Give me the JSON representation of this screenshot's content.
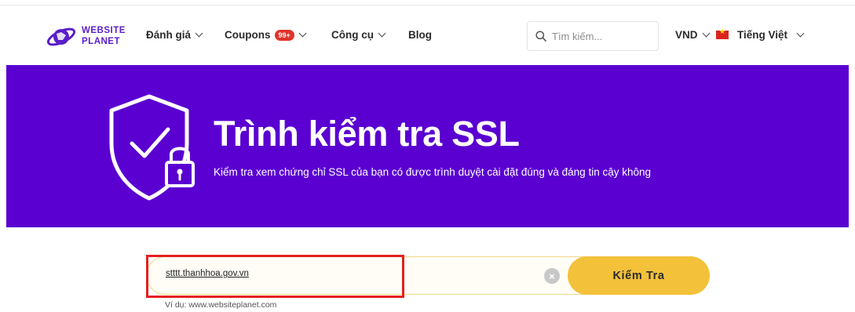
{
  "header": {
    "logo": {
      "line1": "WEBSITE",
      "line2": "PLANET"
    },
    "nav": [
      {
        "label": "Đánh giá",
        "has_dropdown": true
      },
      {
        "label": "Coupons",
        "badge": "99+",
        "has_dropdown": true
      },
      {
        "label": "Công cụ",
        "has_dropdown": true
      },
      {
        "label": "Blog",
        "has_dropdown": false
      }
    ],
    "search": {
      "placeholder": "Tìm kiếm...",
      "icon": "search-icon"
    },
    "currency": "VND",
    "language": "Tiếng Việt"
  },
  "banner": {
    "title": "Trình kiểm tra SSL",
    "subtitle": "Kiểm tra xem chứng chỉ SSL của bạn có được trình duyệt cài đặt đúng và đáng tin cậy không",
    "icon": "shield-lock-icon"
  },
  "checker": {
    "url_value": "stttt.thanhhoa.gov.vn",
    "button_label": "Kiểm Tra",
    "example": "Ví dụ: www.websiteplanet.com"
  },
  "colors": {
    "brand_purple": "#5a00d1",
    "button_yellow": "#f3c13a",
    "highlight_red": "#e5201f",
    "badge_red": "#e0332a"
  }
}
